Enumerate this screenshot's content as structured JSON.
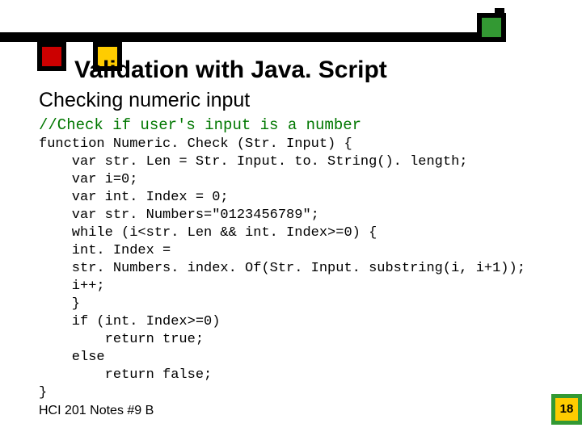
{
  "title": "Validation with Java. Script",
  "subtitle": "Checking numeric input",
  "comment": "//Check if user's input is a number",
  "code": "function Numeric. Check (Str. Input) {\n    var str. Len = Str. Input. to. String(). length;\n    var i=0;\n    var int. Index = 0;\n    var str. Numbers=\"0123456789\";\n    while (i<str. Len && int. Index>=0) {\n    int. Index =\n    str. Numbers. index. Of(Str. Input. substring(i, i+1));\n    i++;\n    }\n    if (int. Index>=0)\n        return true;\n    else\n        return false;\n}",
  "footer": "HCI 201 Notes #9 B",
  "page": "18"
}
